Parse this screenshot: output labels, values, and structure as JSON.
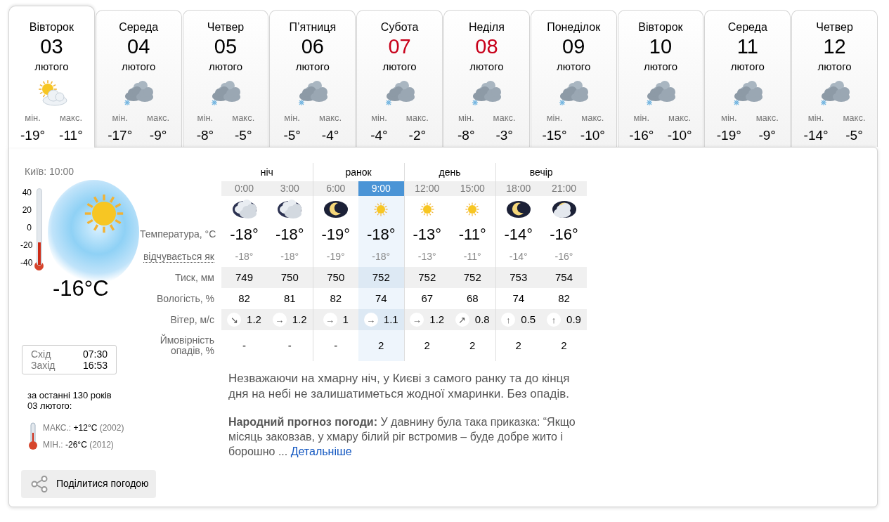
{
  "days": [
    {
      "weekday": "Вівторок",
      "date": "03",
      "month": "лютого",
      "weekend": false,
      "selected": true,
      "kind": "sun-cloud",
      "min_label": "мін.",
      "min": "-19°",
      "max_label": "макс.",
      "max": "-11°"
    },
    {
      "weekday": "Середа",
      "date": "04",
      "month": "лютого",
      "weekend": false,
      "selected": false,
      "kind": "cloud-snow",
      "min_label": "мін.",
      "min": "-17°",
      "max_label": "макс.",
      "max": "-9°"
    },
    {
      "weekday": "Четвер",
      "date": "05",
      "month": "лютого",
      "weekend": false,
      "selected": false,
      "kind": "cloud-snow",
      "min_label": "мін.",
      "min": "-8°",
      "max_label": "макс.",
      "max": "-5°"
    },
    {
      "weekday": "П’ятниця",
      "date": "06",
      "month": "лютого",
      "weekend": false,
      "selected": false,
      "kind": "cloud-snow",
      "min_label": "мін.",
      "min": "-5°",
      "max_label": "макс.",
      "max": "-4°"
    },
    {
      "weekday": "Субота",
      "date": "07",
      "month": "лютого",
      "weekend": true,
      "selected": false,
      "kind": "cloud-snow",
      "min_label": "мін.",
      "min": "-4°",
      "max_label": "макс.",
      "max": "-2°"
    },
    {
      "weekday": "Неділя",
      "date": "08",
      "month": "лютого",
      "weekend": true,
      "selected": false,
      "kind": "cloud-snow",
      "min_label": "мін.",
      "min": "-8°",
      "max_label": "макс.",
      "max": "-3°"
    },
    {
      "weekday": "Понеділок",
      "date": "09",
      "month": "лютого",
      "weekend": false,
      "selected": false,
      "kind": "cloud-snow",
      "min_label": "мін.",
      "min": "-15°",
      "max_label": "макс.",
      "max": "-10°"
    },
    {
      "weekday": "Вівторок",
      "date": "10",
      "month": "лютого",
      "weekend": false,
      "selected": false,
      "kind": "cloud-snow",
      "min_label": "мін.",
      "min": "-16°",
      "max_label": "макс.",
      "max": "-10°"
    },
    {
      "weekday": "Середа",
      "date": "11",
      "month": "лютого",
      "weekend": false,
      "selected": false,
      "kind": "cloud-snow",
      "min_label": "мін.",
      "min": "-19°",
      "max_label": "макс.",
      "max": "-9°"
    },
    {
      "weekday": "Четвер",
      "date": "12",
      "month": "лютого",
      "weekend": false,
      "selected": false,
      "kind": "cloud-snow",
      "min_label": "мін.",
      "min": "-14°",
      "max_label": "макс.",
      "max": "-5°"
    }
  ],
  "current": {
    "place_time": "Київ: 10:00",
    "scale": [
      "40",
      "20",
      "0",
      "-20",
      "-40"
    ],
    "level": 0.3,
    "temperature": "-16°C",
    "sun": [
      {
        "label": "Схід",
        "time": "07:30"
      },
      {
        "label": "Захід",
        "time": "16:53"
      }
    ]
  },
  "history": {
    "title": "за останні 130 років",
    "date": "03 лютого:",
    "records": [
      {
        "label": "МАКС.:",
        "value": "+12°C",
        "year": "(2002)"
      },
      {
        "label": "МІН.:",
        "value": "-26°C",
        "year": "(2012)"
      }
    ]
  },
  "share_button": "Поділитися погодою",
  "periods": [
    "ніч",
    "ранок",
    "день",
    "вечір"
  ],
  "row_labels": {
    "temperature": "Температура, °C",
    "feels": "відчувається як",
    "pressure": "Тиск, мм",
    "humidity": "Вологість, %",
    "wind": "Вітер, м/с",
    "precip": "Ймовірність опадів, %"
  },
  "hours": [
    {
      "time": "0:00",
      "selected": false,
      "kind": "cloud-night",
      "temperature": "-18°",
      "feels": "-18°",
      "pressure": "749",
      "humidity": "82",
      "wind_dir": "↘",
      "wind": "1.2",
      "precip": "-"
    },
    {
      "time": "3:00",
      "selected": false,
      "kind": "cloud-night",
      "temperature": "-18°",
      "feels": "-18°",
      "pressure": "750",
      "humidity": "81",
      "wind_dir": "→",
      "wind": "1.2",
      "precip": "-"
    },
    {
      "time": "6:00",
      "selected": false,
      "kind": "moon",
      "temperature": "-19°",
      "feels": "-19°",
      "pressure": "750",
      "humidity": "82",
      "wind_dir": "→",
      "wind": "1",
      "precip": "-"
    },
    {
      "time": "9:00",
      "selected": true,
      "kind": "sun",
      "temperature": "-18°",
      "feels": "-18°",
      "pressure": "752",
      "humidity": "74",
      "wind_dir": "→",
      "wind": "1.1",
      "precip": "2"
    },
    {
      "time": "12:00",
      "selected": false,
      "kind": "sun",
      "temperature": "-13°",
      "feels": "-13°",
      "pressure": "752",
      "humidity": "67",
      "wind_dir": "→",
      "wind": "1.2",
      "precip": "2"
    },
    {
      "time": "15:00",
      "selected": false,
      "kind": "sun",
      "temperature": "-11°",
      "feels": "-11°",
      "pressure": "752",
      "humidity": "68",
      "wind_dir": "↗",
      "wind": "0.8",
      "precip": "2"
    },
    {
      "time": "18:00",
      "selected": false,
      "kind": "moon",
      "temperature": "-14°",
      "feels": "-14°",
      "pressure": "753",
      "humidity": "74",
      "wind_dir": "↑",
      "wind": "0.5",
      "precip": "2"
    },
    {
      "time": "21:00",
      "selected": false,
      "kind": "moon-cloud",
      "temperature": "-16°",
      "feels": "-16°",
      "pressure": "754",
      "humidity": "82",
      "wind_dir": "↑",
      "wind": "0.9",
      "precip": "2"
    }
  ],
  "description": "Незважаючи на хмарну ніч, у Києві з самого ранку та до кінця дня на небі не залишатиметься жодної хмаринки. Без опадів.",
  "folk": {
    "text": "**Народний прогноз погоди:** У давнину була така приказка: “Якщо місяць заковзав, у хмару білий ріг встромив – буде добре жито і борошно ...",
    "link": "Детальніше"
  }
}
